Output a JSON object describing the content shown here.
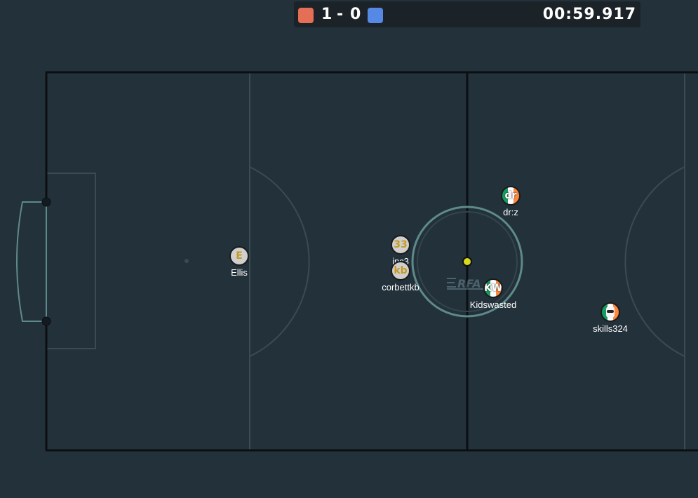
{
  "score": {
    "red": "1",
    "separator": "-",
    "blue": "0",
    "red_color": "#e56e56",
    "blue_color": "#5689e5"
  },
  "timer": "00:59.917",
  "colors": {
    "background": "#23313a",
    "pitch_line": "#0b0f12",
    "marking": "#3a4b55",
    "goal": "#5e8a8a",
    "ball": "#d9d91f"
  },
  "watermark": "RFA",
  "players": [
    {
      "name": "Ellis",
      "avatar": "E",
      "style": "plain"
    },
    {
      "name": "inc3",
      "avatar": "33",
      "style": "plain"
    },
    {
      "name": "corbettkb",
      "avatar": "kb",
      "style": "plain"
    },
    {
      "name": "dr:z",
      "avatar": "dr",
      "style": "tricolor"
    },
    {
      "name": "Kidswasted",
      "avatar": "KW",
      "style": "tricolor"
    },
    {
      "name": "skills324",
      "avatar": "face-icon",
      "style": "tricolor"
    }
  ]
}
